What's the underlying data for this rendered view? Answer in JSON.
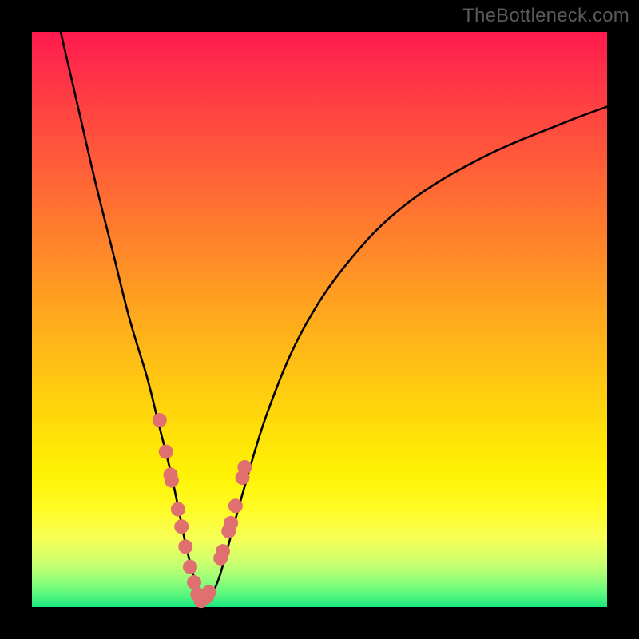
{
  "watermark": "TheBottleneck.com",
  "chart_data": {
    "type": "line",
    "title": "",
    "xlabel": "",
    "ylabel": "",
    "xlim": [
      0,
      100
    ],
    "ylim": [
      0,
      100
    ],
    "grid": false,
    "legend": false,
    "series": [
      {
        "name": "bottleneck-curve",
        "x": [
          5,
          8,
          11,
          14,
          17,
          20,
          22,
          24,
          25.5,
          26.7,
          27.7,
          28.5,
          29.2,
          30,
          31,
          32.5,
          34.5,
          37,
          41,
          47,
          55,
          65,
          78,
          92,
          100
        ],
        "y": [
          100,
          87,
          74,
          62,
          50,
          40,
          32,
          24,
          17,
          11,
          7,
          4,
          2,
          0.8,
          1.8,
          5,
          12,
          21,
          34,
          48,
          60,
          70,
          78,
          84,
          87
        ]
      }
    ],
    "markers": {
      "name": "highlighted-points",
      "x": [
        22.2,
        23.3,
        24.1,
        24.3,
        25.4,
        26.0,
        26.7,
        27.5,
        28.2,
        28.8,
        29.4,
        30.4,
        30.8,
        32.8,
        33.2,
        34.2,
        34.6,
        35.4,
        36.6,
        37.0
      ],
      "y": [
        32.5,
        27.0,
        23.0,
        22.0,
        17.0,
        14.0,
        10.5,
        7.0,
        4.3,
        2.2,
        1.1,
        1.8,
        2.6,
        8.5,
        9.7,
        13.2,
        14.6,
        17.6,
        22.5,
        24.3
      ]
    },
    "background_gradient": {
      "top": "#ff1a4e",
      "middle": "#ffe108",
      "bottom": "#19e67f"
    }
  }
}
